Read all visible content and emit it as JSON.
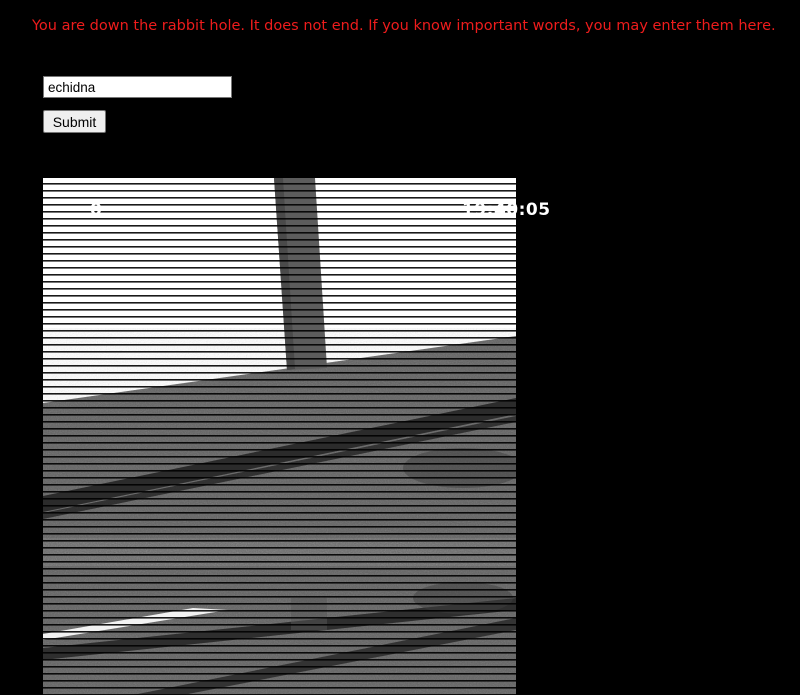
{
  "intro": {
    "text": "You are down the rabbit hole. It does not end. If you know important words, you may enter them here."
  },
  "form": {
    "input_value": "echidna",
    "submit_label": "Submit"
  },
  "game": {
    "hud_left": "0",
    "hud_clock": "19:40:05"
  },
  "colors": {
    "background": "#000000",
    "intro_text": "#ee1c1c",
    "hud_text": "#ffffff"
  }
}
